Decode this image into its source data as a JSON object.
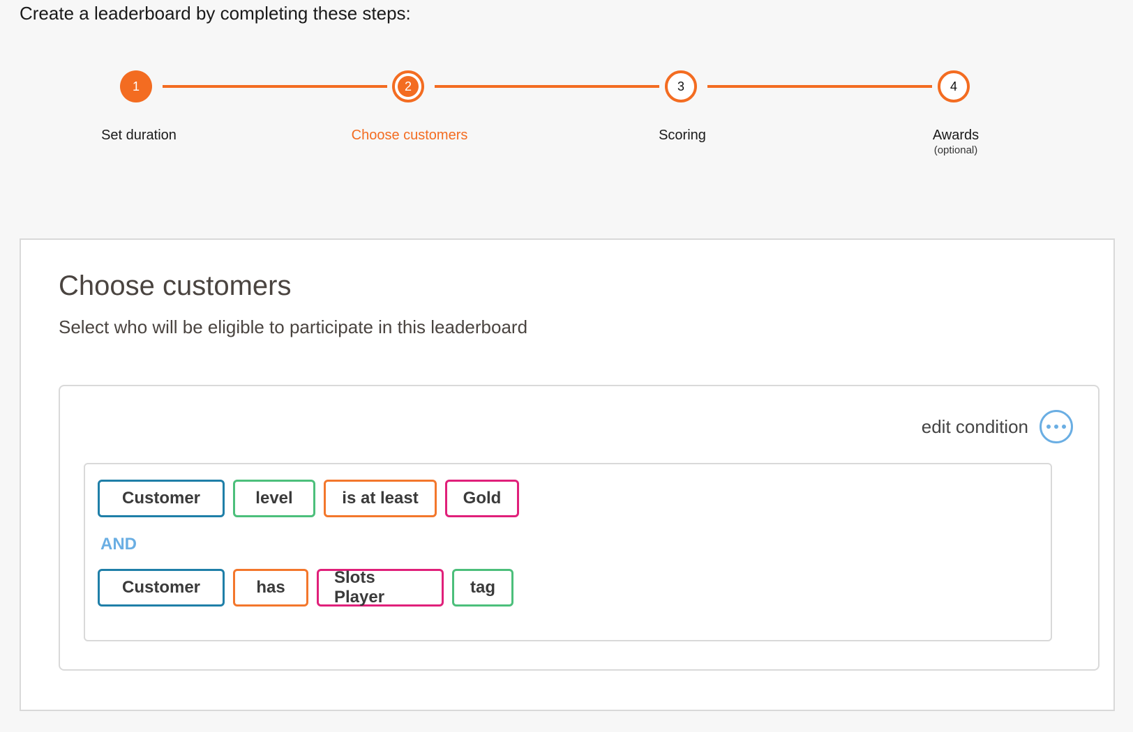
{
  "intro": "Create a leaderboard by completing these steps:",
  "steps": [
    {
      "number": "1",
      "label": "Set duration",
      "sublabel": "",
      "state": "done"
    },
    {
      "number": "2",
      "label": "Choose customers",
      "sublabel": "",
      "state": "active"
    },
    {
      "number": "3",
      "label": "Scoring",
      "sublabel": "",
      "state": "todo"
    },
    {
      "number": "4",
      "label": "Awards",
      "sublabel": "(optional)",
      "state": "todo"
    }
  ],
  "panel": {
    "title": "Choose customers",
    "subtitle": "Select who will be eligible to participate in this leaderboard",
    "edit_label": "edit condition",
    "edit_icon": "more-dots-icon",
    "conjunction": "AND",
    "rules": [
      {
        "entity": "Customer",
        "attribute": "level",
        "operator": "is at least",
        "value": "Gold"
      },
      {
        "entity": "Customer",
        "operator": "has",
        "value": "Slots Player",
        "attribute": "tag"
      }
    ]
  },
  "colors": {
    "accent": "#f36c21",
    "link_blue": "#6aaee3",
    "entity_border": "#1f7fa8",
    "attribute_border": "#4cbf7b",
    "operator_border": "#f3772c",
    "value_border": "#e0207a"
  }
}
